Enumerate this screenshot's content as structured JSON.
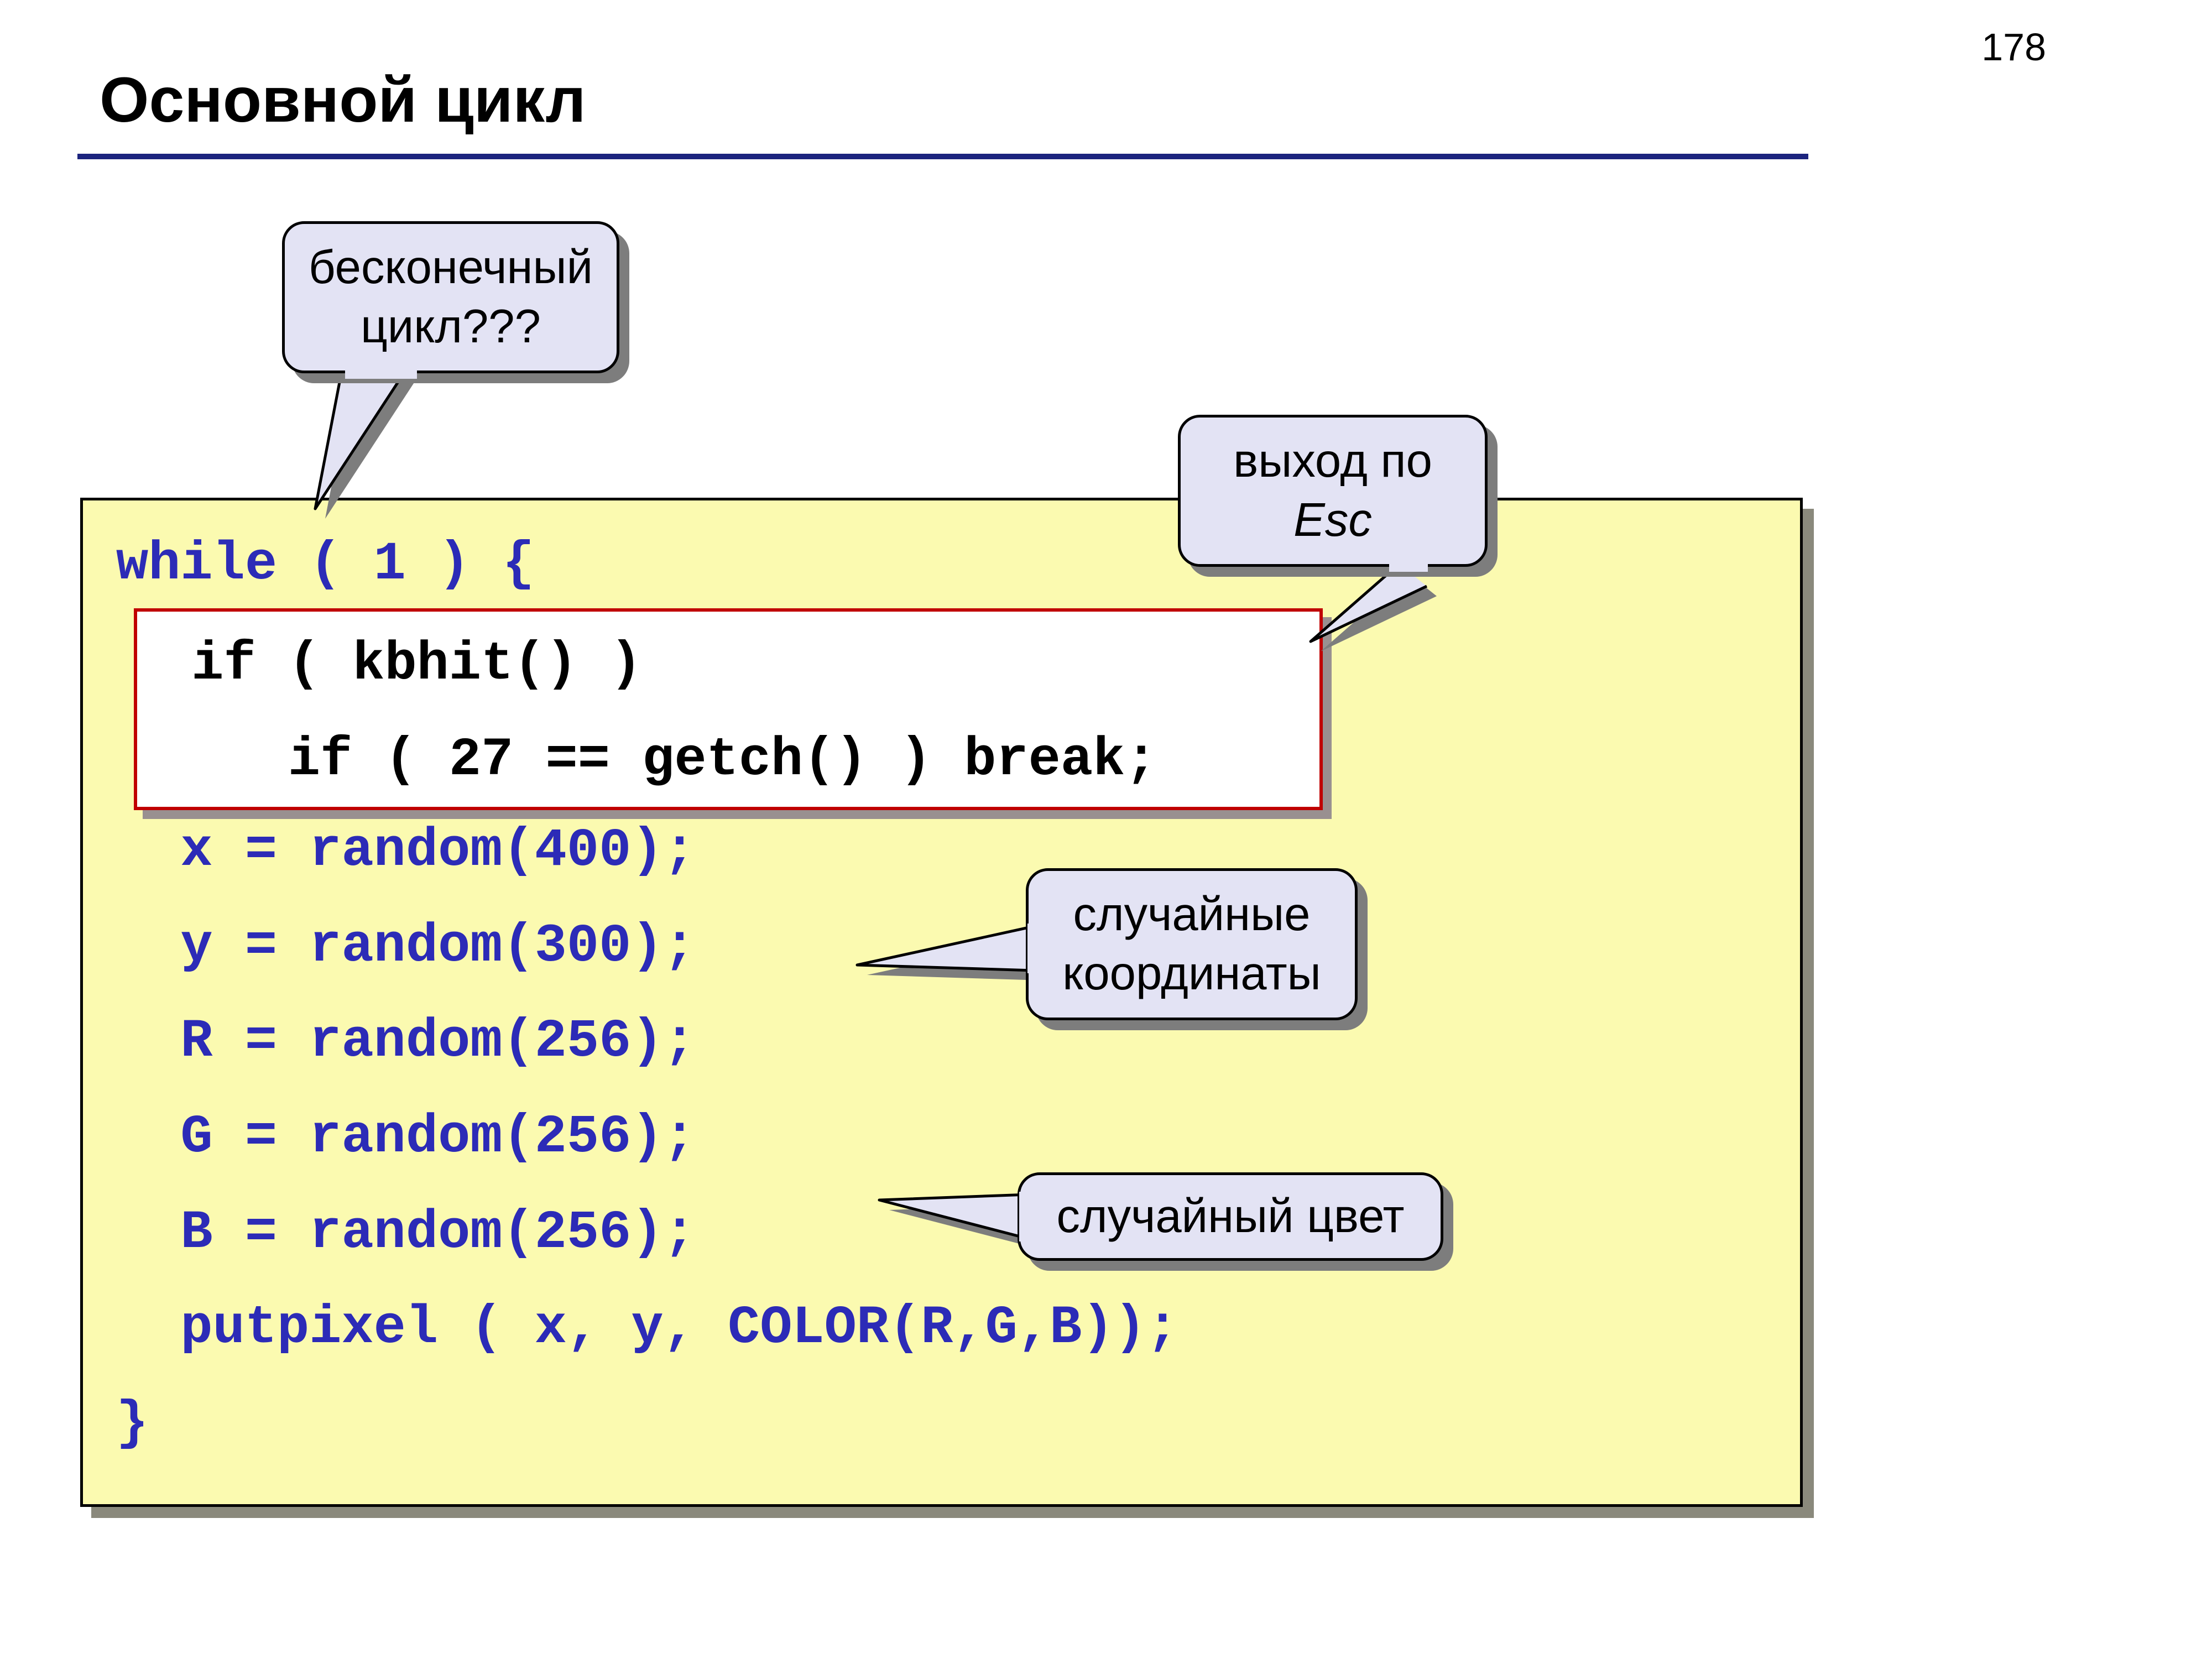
{
  "page_number": "178",
  "heading": "Основной цикл",
  "code": {
    "line1": "while ( 1 ) {",
    "line3": "  x = random(400);",
    "line4": "  y = random(300);",
    "line5": "  R = random(256);",
    "line6": "  G = random(256);",
    "line7": "  B = random(256);",
    "line8": "  putpixel ( x, y, COLOR(R,G,B));",
    "line9": "}",
    "highlight1": " if ( kbhit() )",
    "highlight2": "    if ( 27 == getch() ) break;"
  },
  "callouts": {
    "infinite_l1": "бесконечный",
    "infinite_l2": "цикл???",
    "esc_l1": "выход по",
    "esc_l2": "Esc",
    "coords_l1": "случайные",
    "coords_l2": "координаты",
    "color_l1": "случайный цвет"
  }
}
